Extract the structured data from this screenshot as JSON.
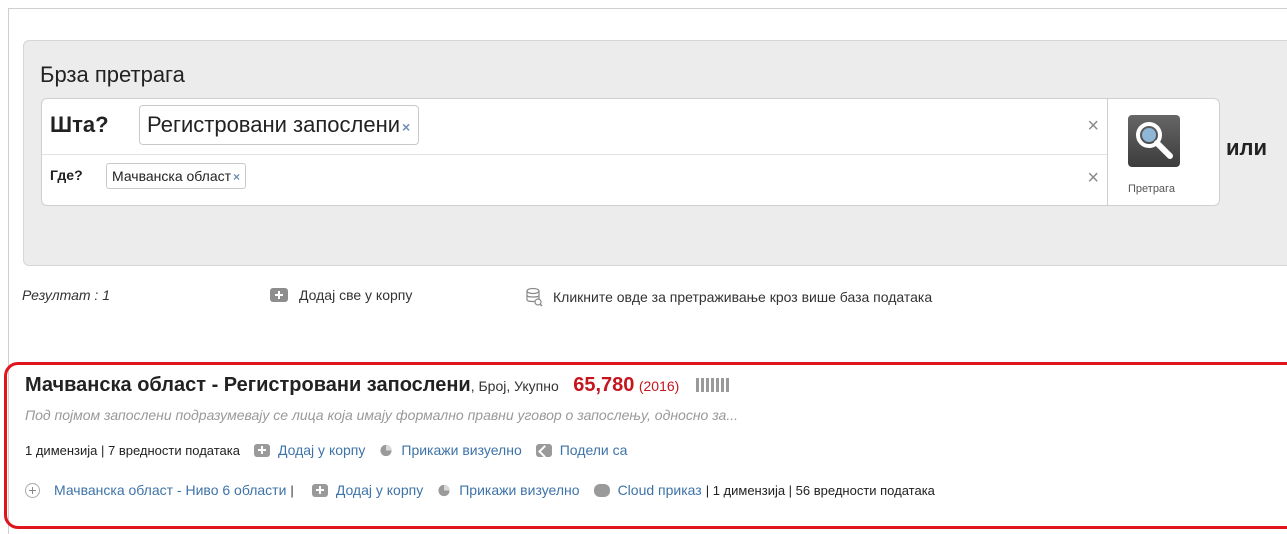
{
  "search": {
    "title": "Брза претрага",
    "what_label": "Шта?",
    "what_tag": "Регистровани запослени",
    "where_label": "Где?",
    "where_tag": "Мачванска област",
    "clear_symbol": "×",
    "tag_remove_symbol": "×",
    "button_label": "Претрага",
    "or_label": "или"
  },
  "results_bar": {
    "count": "Резултат : 1",
    "add_all": "Додај све у корпу",
    "multi_db": "Кликните овде за претраживање кроз више база података"
  },
  "result": {
    "title": "Мачванска област - Регистровани запослени",
    "subtitle": ", Број, Укупно",
    "value": "65,780",
    "year": "(2016)",
    "description": "Под појмом запослени подразумевају се лица која имају формално правни уговор о запослењу, односно за...",
    "line1_meta": "1 димензија | 7 вредности података",
    "add_to_basket": "Додај у корпу",
    "show_visual": "Прикажи визуелно",
    "share_with": "Подели са",
    "line2_link": "Мачванска област - Ниво 6 области",
    "line2_sep": "|",
    "cloud_view": "Cloud приказ",
    "line2_meta": "| 1 димензија | 56 вредности података"
  },
  "icons": {
    "search": "magnifier-icon",
    "add": "plus-box-icon",
    "database": "database-search-icon",
    "pie": "pie-chart-icon",
    "share": "share-icon",
    "cloud": "cloud-icon",
    "expand": "expand-plus-icon"
  },
  "colors": {
    "accent_red": "#c4161c",
    "link_blue": "#3e73a8",
    "highlight_border": "#e0141b"
  }
}
